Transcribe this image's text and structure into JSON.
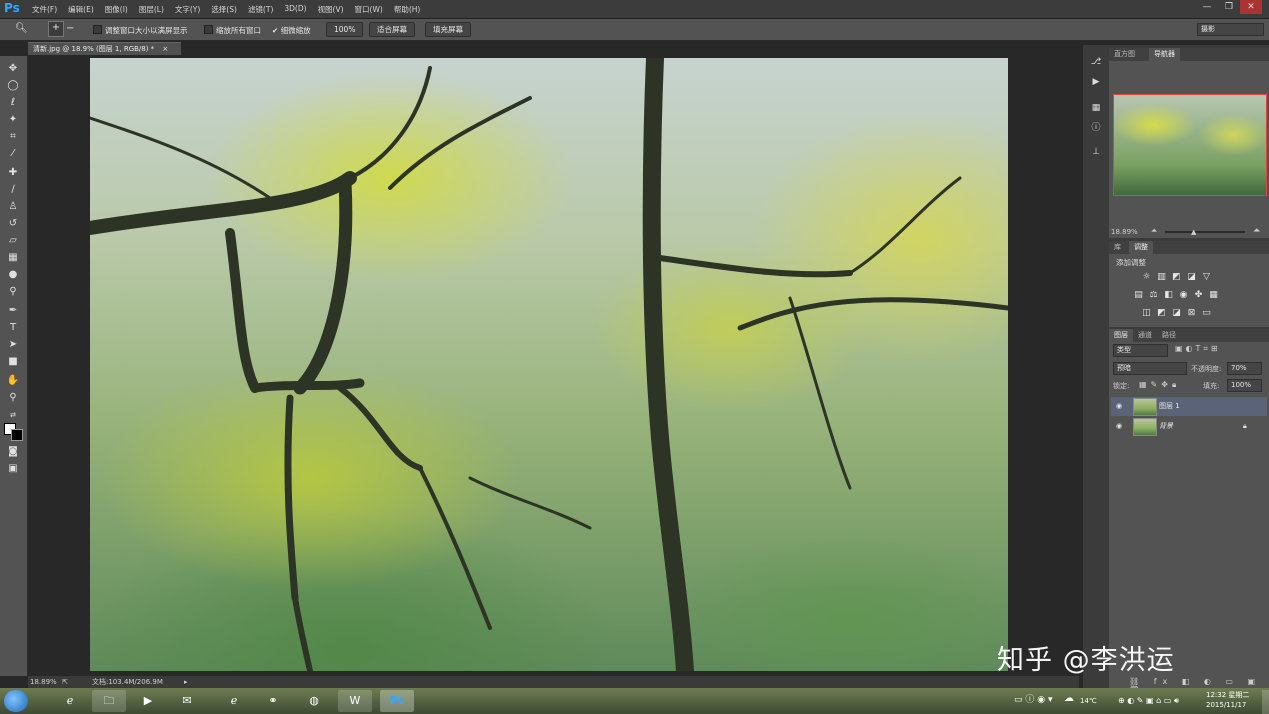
{
  "app": {
    "logo": "Ps"
  },
  "menu": [
    "文件(F)",
    "编辑(E)",
    "图像(I)",
    "图层(L)",
    "文字(Y)",
    "选择(S)",
    "滤镜(T)",
    "3D(D)",
    "视图(V)",
    "窗口(W)",
    "帮助(H)"
  ],
  "window_controls": {
    "minimize": "—",
    "restore": "❐",
    "close": "✕"
  },
  "options_bar": {
    "resize_windows": "调整窗口大小以满屏显示",
    "zoom_all": "缩放所有窗口",
    "scrubby_zoom": "细微缩放",
    "scrubby_checked": true,
    "btn_100": "100%",
    "btn_fit": "适合屏幕",
    "btn_fill": "填充屏幕",
    "workspace": "摄影"
  },
  "document": {
    "tab_label": "清新.jpg @ 18.9% (图层 1, RGB/8) *",
    "close": "×"
  },
  "status": {
    "zoom": "18.89%",
    "doc_size": "文档:103.4M/206.9M"
  },
  "navigator": {
    "tabs": [
      "直方图",
      "导航器"
    ],
    "active_tab": "导航器",
    "zoom": "18.89%"
  },
  "adjustments": {
    "tabs": [
      "库",
      "调整"
    ],
    "active_tab": "调整",
    "title": "添加调整"
  },
  "layers_panel": {
    "tabs": [
      "图层",
      "通道",
      "路径"
    ],
    "active_tab": "图层",
    "filter_kind": "类型",
    "blend_mode": "预暗",
    "opacity_label": "不透明度:",
    "opacity_value": "70%",
    "lock_label": "锁定:",
    "fill_label": "填充:",
    "fill_value": "100%",
    "layers": [
      {
        "name": "图层 1",
        "selected": true,
        "locked": false
      },
      {
        "name": "背景",
        "selected": false,
        "locked": true
      }
    ]
  },
  "taskbar": {
    "temperature": "14℃",
    "time": "12:32",
    "weekday": "星期二",
    "date": "2015/11/17"
  },
  "watermark": "知乎 @李洪运",
  "colors": {
    "accent": "#31a8ff",
    "panel": "#535353",
    "nav_frame": "#dd4444"
  }
}
